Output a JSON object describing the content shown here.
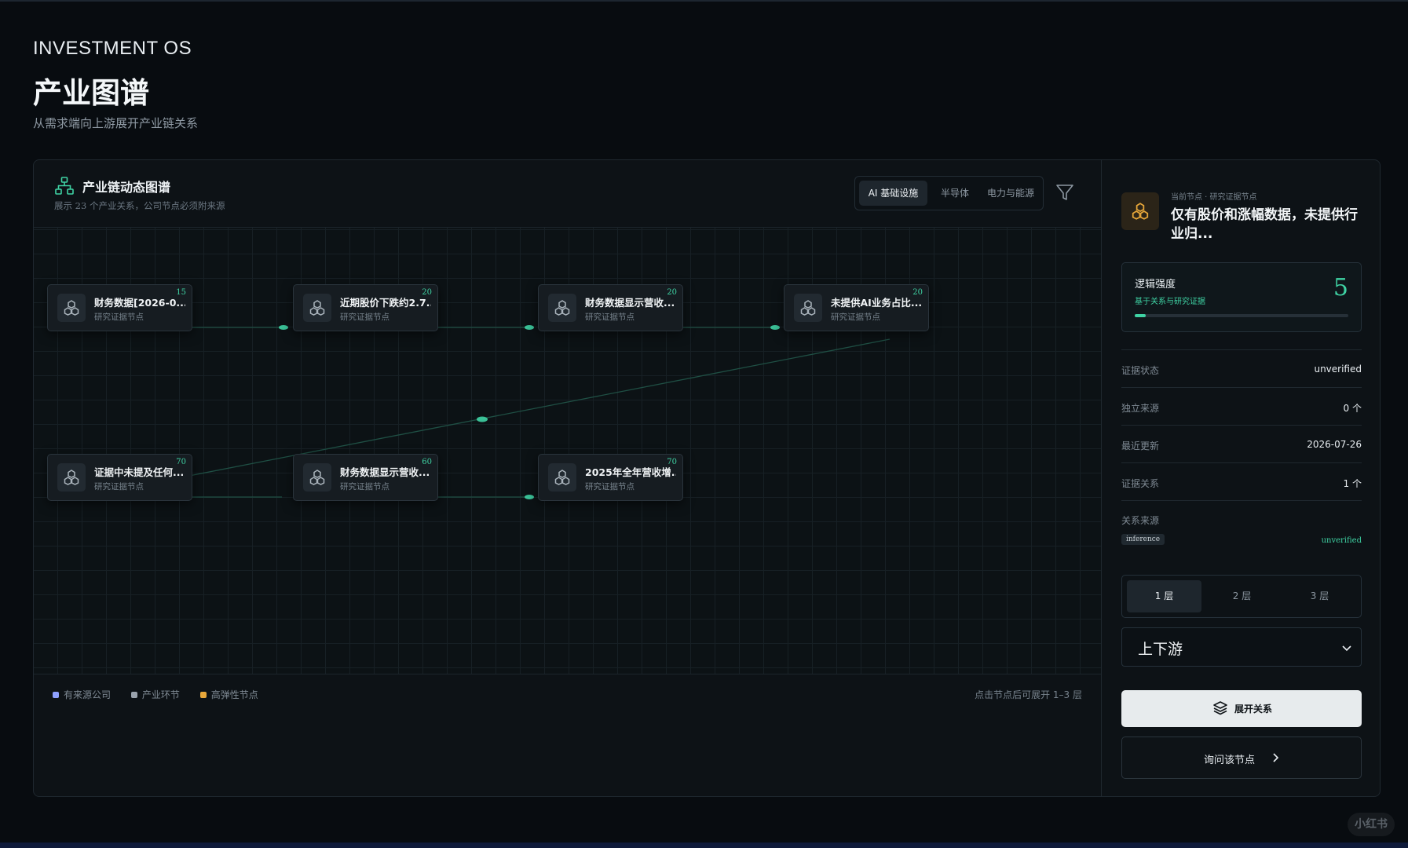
{
  "header": {
    "brand": "INVESTMENT OS",
    "title": "产业图谱",
    "subtitle": "从需求端向上游展开产业链关系"
  },
  "graph": {
    "title": "产业链动态图谱",
    "subtitle": "展示 23 个产业关系，公司节点必须附来源",
    "tabs": [
      {
        "label": "AI 基础设施",
        "active": true
      },
      {
        "label": "半导体",
        "active": false
      },
      {
        "label": "电力与能源",
        "active": false
      }
    ],
    "nodes": [
      {
        "label": "财务数据[2026-0...",
        "sub": "研究证据节点",
        "score": "15"
      },
      {
        "label": "近期股价下跌约2.7...",
        "sub": "研究证据节点",
        "score": "20"
      },
      {
        "label": "财务数据显示营收...",
        "sub": "研究证据节点",
        "score": "20"
      },
      {
        "label": "未提供AI业务占比...",
        "sub": "研究证据节点",
        "score": "20"
      },
      {
        "label": "证据中未提及任何...",
        "sub": "研究证据节点",
        "score": "70"
      },
      {
        "label": "财务数据显示营收...",
        "sub": "研究证据节点",
        "score": "60"
      },
      {
        "label": "2025年全年营收增...",
        "sub": "研究证据节点",
        "score": "70"
      }
    ],
    "legend": [
      {
        "label": "有来源公司",
        "color": "#8ea0ff"
      },
      {
        "label": "产业环节",
        "color": "#9aa3ad"
      },
      {
        "label": "高弹性节点",
        "color": "#e8a83a"
      }
    ],
    "hint": "点击节点后可展开 1–3 层"
  },
  "detail": {
    "eyebrow": "当前节点 · 研究证据节点",
    "title": "仅有股价和涨幅数据，未提供行业归...",
    "strength": {
      "label": "逻辑强度",
      "sub": "基于关系与研究证据",
      "value": "5",
      "fraction": 0.05
    },
    "rows": [
      {
        "key": "证据状态",
        "value": "unverified"
      },
      {
        "key": "独立来源",
        "value": "0 个"
      },
      {
        "key": "最近更新",
        "value": "2026-07-26"
      },
      {
        "key": "证据关系",
        "value": "1 个"
      }
    ],
    "source": {
      "label": "关系来源",
      "tag": "inference",
      "status": "unverified"
    },
    "layers": [
      {
        "label": "1 层",
        "active": true
      },
      {
        "label": "2 层",
        "active": false
      },
      {
        "label": "3 层",
        "active": false
      }
    ],
    "direction": "上下游",
    "expand_label": "展开关系",
    "ask_label": "询问该节点"
  },
  "colors": {
    "accent": "#3fd3a4",
    "background": "#080c10",
    "panel": "#0d1216",
    "node_icon_current": "#e8a83a"
  },
  "watermark": "小红书"
}
